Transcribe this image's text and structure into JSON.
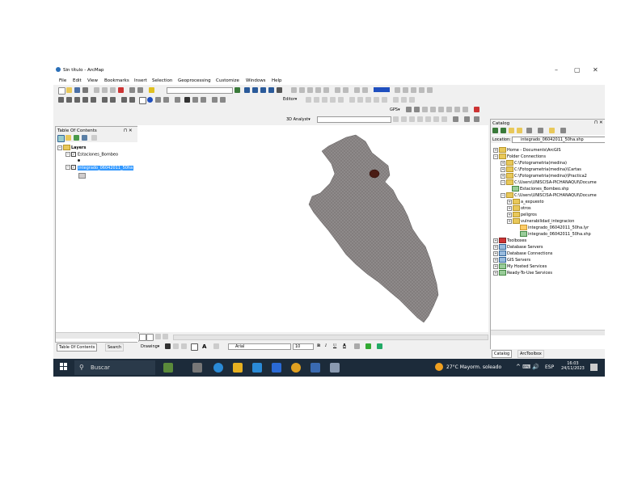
{
  "window": {
    "title": "Sin título - ArcMap",
    "minimize": "–",
    "maximize": "▢",
    "close": "✕"
  },
  "menu": [
    "File",
    "Edit",
    "View",
    "Bookmarks",
    "Insert",
    "Selection",
    "Geoprocessing",
    "Customize",
    "Windows",
    "Help"
  ],
  "toolbar": {
    "editor_label": "Editor▾",
    "gps_label": "GPS▾",
    "analyst_label": "3D Analyst▾"
  },
  "toc": {
    "title": "Table Of Contents",
    "pin": "⊓ ✕",
    "layers_label": "Layers",
    "layer1": "Estaciones_Bombeo",
    "layer2": "integrado_06042011_50ha",
    "tab1": "Table Of Contents",
    "tab2": "Search"
  },
  "catalog": {
    "title": "Catalog",
    "location_label": "Location:",
    "location_value": "integrado_06042011_50ha.shp",
    "items": [
      "Home - Documents\\ArcGIS",
      "Folder Connections",
      "C:\\Fotogrametria(medina)",
      "C:\\Fotogrametria(medina)\\Cartas",
      "C:\\Fotogrametria(medina)\\Practica2",
      "C:\\Users\\UNISCISA-PICHANAQUI\\Docume",
      "Estaciones_Bombeo.shp",
      "C:\\Users\\UNISCISA-PICHANAQUI\\Docume",
      "a_expuesto",
      "otros",
      "peligros",
      "vulnerabilidad_integracion",
      "integrado_06042011_50ha.lyr",
      "integrado_06042011_50ha.shp",
      "Toolboxes",
      "Database Servers",
      "Database Connections",
      "GIS Servers",
      "My Hosted Services",
      "Ready-To-Use Services"
    ],
    "tab1": "Catalog",
    "tab2": "ArcToolbox"
  },
  "drawing": {
    "label": "Drawing▾",
    "font": "Arial",
    "size": "10",
    "bold": "B",
    "italic": "I",
    "underline": "U"
  },
  "taskbar": {
    "search": "Buscar",
    "weather": "27°C  Mayorm. soleado",
    "lang": "ESP",
    "time": "16:03",
    "date": "24/11/2023"
  },
  "colors": {
    "taskbar": "#1c2b3a",
    "map_fill": "#8a8585",
    "selection": "#3399ff"
  }
}
